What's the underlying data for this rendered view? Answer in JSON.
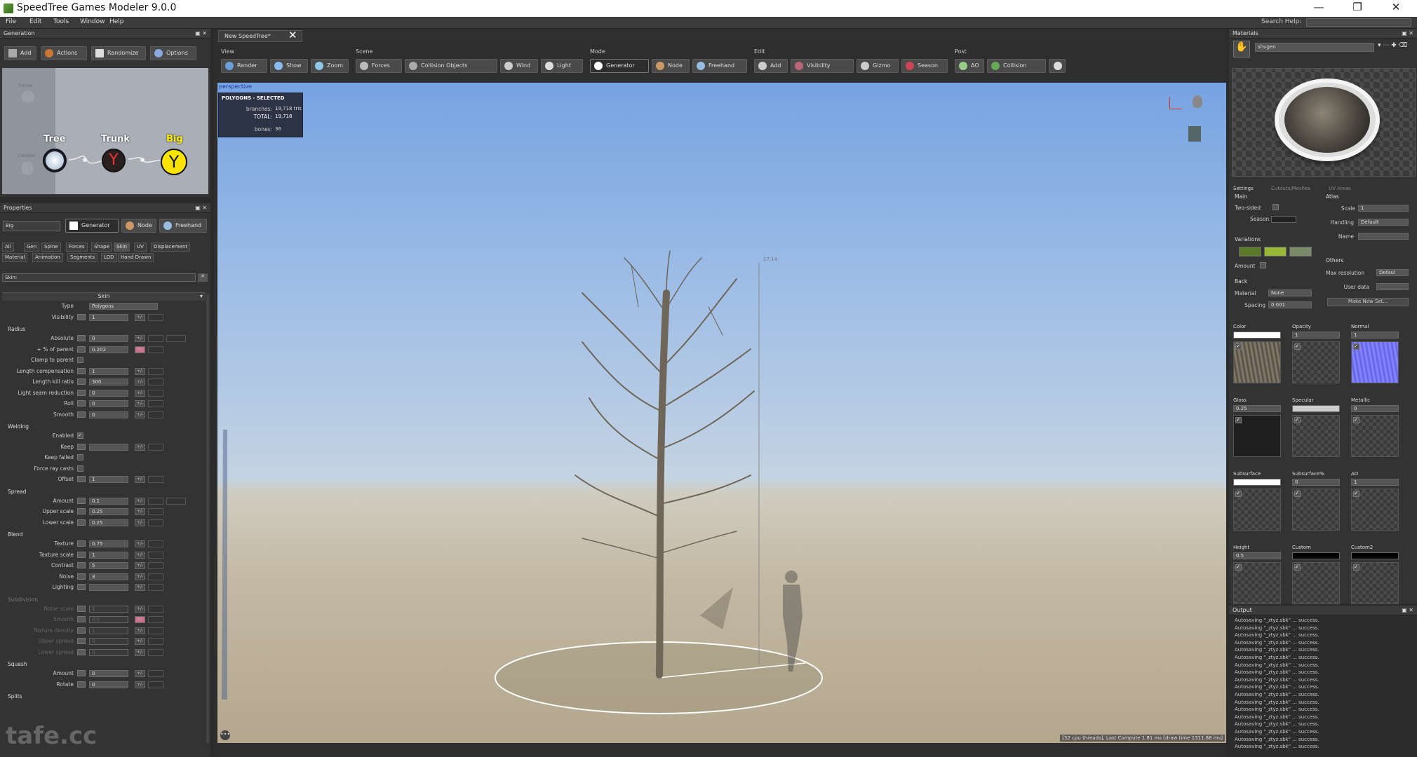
{
  "app": {
    "title": "SpeedTree Games Modeler 9.0.0"
  },
  "menu": [
    "File",
    "Edit",
    "Tools",
    "Window",
    "Help"
  ],
  "search_help_label": "Search Help:",
  "generation": {
    "title": "Generation",
    "buttons": [
      "Add",
      "Actions",
      "Randomize",
      "Options"
    ],
    "nodes": [
      {
        "label": "Tree",
        "color": "#e8f0ff"
      },
      {
        "label": "Trunk",
        "color": "#ffffff"
      },
      {
        "label": "Big",
        "color": "#ffee00"
      }
    ],
    "ghost": [
      "Forces",
      "Collision"
    ]
  },
  "document_tab": "New SpeedTree*",
  "toolbar": {
    "groups": [
      {
        "label": "View",
        "items": [
          {
            "t": "Render",
            "c": "#6a9fd8"
          },
          {
            "t": "Show",
            "c": "#88bbee"
          },
          {
            "t": "Zoom",
            "c": "#8fc8e8"
          }
        ]
      },
      {
        "label": "Scene",
        "items": [
          {
            "t": "Forces",
            "c": "#bbbbbb"
          },
          {
            "t": "Collision Objects",
            "c": "#aaaaaa"
          },
          {
            "t": "Wind",
            "c": "#cccccc"
          },
          {
            "t": "Light",
            "c": "#dddddd"
          }
        ]
      },
      {
        "label": "Mode",
        "items": [
          {
            "t": "Generator",
            "c": "#ffffff",
            "on": true
          },
          {
            "t": "Node",
            "c": "#cc9966"
          },
          {
            "t": "Freehand",
            "c": "#99bbdd"
          }
        ]
      },
      {
        "label": "Edit",
        "items": [
          {
            "t": "Add",
            "c": "#cccccc"
          },
          {
            "t": "Visibility",
            "c": "#bb6677"
          },
          {
            "t": "Gizmo",
            "c": "#cccccc"
          },
          {
            "t": "Season",
            "c": "#cc4455"
          }
        ]
      },
      {
        "label": "Post",
        "items": [
          {
            "t": "AO",
            "c": "#99cc88"
          },
          {
            "t": "Collision",
            "c": "#66aa55"
          },
          {
            "t": "",
            "c": "#dddddd"
          }
        ]
      }
    ]
  },
  "viewport": {
    "label": "perspective",
    "info_title": "POLYGONS - SELECTED",
    "branches_label": "branches:",
    "branches_value": "19,718 tris",
    "total_label": "TOTAL:",
    "total_value": "19,718",
    "bones_label": "bones:",
    "bones_value": "36",
    "height_marker": "27.14",
    "status": "[32 cpu threads], Last Compute 1.81 ms [draw time 1311.86 ms]"
  },
  "properties": {
    "title": "Properties",
    "name_value": "Big",
    "mode_buttons": [
      "Generator",
      "Node",
      "Freehand"
    ],
    "tabs_row1": [
      "All",
      "Gen",
      "Spine",
      "Forces",
      "Shape",
      "Skin",
      "UV",
      "Displacement"
    ],
    "tabs_row2": [
      "Material",
      "Animation",
      "Segments",
      "LOD",
      "Hand Drawn"
    ],
    "filter": "Skin:",
    "section": "Skin",
    "rows": [
      {
        "k": "label",
        "t": "Type",
        "v": "Polygons",
        "dd": true
      },
      {
        "k": "label",
        "t": "Visibility",
        "v": "1"
      },
      {
        "k": "sec",
        "t": "Radius"
      },
      {
        "k": "label",
        "t": "Absolute",
        "v": "0",
        "curve": true
      },
      {
        "k": "label",
        "t": "+ % of parent",
        "v": "0.202",
        "pink": true
      },
      {
        "k": "check",
        "t": "Clamp to parent"
      },
      {
        "k": "label",
        "t": "Length compensation",
        "v": "1"
      },
      {
        "k": "label",
        "t": "Length kill ratio",
        "v": "300"
      },
      {
        "k": "label",
        "t": "Light seam reduction",
        "v": "0"
      },
      {
        "k": "label",
        "t": "Roll",
        "v": "0"
      },
      {
        "k": "label",
        "t": "Smooth",
        "v": "0"
      },
      {
        "k": "sec",
        "t": "Welding"
      },
      {
        "k": "check",
        "t": "Enabled",
        "on": true
      },
      {
        "k": "label",
        "t": "Keep",
        "v": ""
      },
      {
        "k": "check",
        "t": "Keep failed"
      },
      {
        "k": "check",
        "t": "Force ray casts"
      },
      {
        "k": "label",
        "t": "Offset",
        "v": "1"
      },
      {
        "k": "sec",
        "t": "Spread"
      },
      {
        "k": "label",
        "t": "Amount",
        "v": "0.1",
        "curve": true
      },
      {
        "k": "label",
        "t": "Upper scale",
        "v": "0.25"
      },
      {
        "k": "label",
        "t": "Lower scale",
        "v": "0.25"
      },
      {
        "k": "sec",
        "t": "Blend"
      },
      {
        "k": "label",
        "t": "Texture",
        "v": "0.75"
      },
      {
        "k": "label",
        "t": "Texture scale",
        "v": "1"
      },
      {
        "k": "label",
        "t": "Contrast",
        "v": "5"
      },
      {
        "k": "label",
        "t": "Noise",
        "v": "3"
      },
      {
        "k": "label",
        "t": "Lighting",
        "v": ""
      },
      {
        "k": "sec",
        "t": "Subdivision",
        "dim": true
      },
      {
        "k": "label",
        "t": "Noise scale",
        "v": "1",
        "dim": true
      },
      {
        "k": "label",
        "t": "Smooth",
        "v": "0.5",
        "dim": true,
        "pink": true
      },
      {
        "k": "label",
        "t": "Texture density",
        "v": "1",
        "dim": true
      },
      {
        "k": "label",
        "t": "Upper spread",
        "v": "0",
        "dim": true
      },
      {
        "k": "label",
        "t": "Lower spread",
        "v": "0",
        "dim": true
      },
      {
        "k": "sec",
        "t": "Squash"
      },
      {
        "k": "label",
        "t": "Amount",
        "v": "0"
      },
      {
        "k": "label",
        "t": "Rotate",
        "v": "0"
      },
      {
        "k": "sec",
        "t": "Splits"
      }
    ]
  },
  "materials": {
    "title": "Materials",
    "name_value": "shugen",
    "tabs": [
      "Settings",
      "Cutouts/Meshes",
      "UV Areas"
    ],
    "main": {
      "label": "Main",
      "two_sided": "Two-sided",
      "season": "Season"
    },
    "atlas": {
      "label": "Atlas",
      "scale_label": "Scale",
      "scale_value": "1",
      "handling_label": "Handling",
      "handling_value": "Default",
      "name_label": "Name"
    },
    "variations": {
      "label": "Variations",
      "amount": "Amount",
      "swatches": [
        "#5a7a2a",
        "#9ab838",
        "#7a8a6a"
      ]
    },
    "others": {
      "label": "Others",
      "maxres_label": "Max resolution",
      "maxres_value": "Defaul",
      "userdata_label": "User data",
      "make_set": "Make New Set..."
    },
    "back": {
      "label": "Back",
      "material_label": "Material",
      "material_value": "None",
      "spacing_label": "Spacing",
      "spacing_value": "0.001"
    },
    "maps": [
      {
        "name": "Color",
        "val": "",
        "swatch": "#ffffff",
        "tex": "bark"
      },
      {
        "name": "Opacity",
        "val": "1",
        "tex": "empty"
      },
      {
        "name": "Normal",
        "val": "1",
        "tex": "normal"
      },
      {
        "name": "Gloss",
        "val": "0.25",
        "tex": "dark"
      },
      {
        "name": "Specular",
        "val": "",
        "swatch": "#cccccc",
        "tex": "empty"
      },
      {
        "name": "Metallic",
        "val": "0",
        "tex": "empty"
      },
      {
        "name": "Subsurface",
        "val": "",
        "swatch": "#ffffff",
        "tex": "empty"
      },
      {
        "name": "Subsurface%",
        "val": "0",
        "tex": "empty"
      },
      {
        "name": "AO",
        "val": "1",
        "tex": "empty"
      },
      {
        "name": "Height",
        "val": "0.5",
        "tex": "empty"
      },
      {
        "name": "Custom",
        "val": "",
        "swatch": "#000000",
        "tex": "empty"
      },
      {
        "name": "Custom2",
        "val": "",
        "swatch": "#000000",
        "tex": "empty"
      }
    ]
  },
  "output": {
    "title": "Output",
    "lines": [
      "Autosaving \"_ztyz.sbk\" ... success.",
      "Autosaving \"_ztyz.sbk\" ... success.",
      "Autosaving \"_ztyz.sbk\" ... success.",
      "Autosaving \"_ztyz.sbk\" ... success.",
      "Autosaving \"_ztyz.sbk\" ... success.",
      "Autosaving \"_ztyz.sbk\" ... success.",
      "Autosaving \"_ztyz.sbk\" ... success.",
      "Autosaving \"_ztyz.sbk\" ... success.",
      "Autosaving \"_ztyz.sbk\" ... success.",
      "Autosaving \"_ztyz.sbk\" ... success.",
      "Autosaving \"_ztyz.sbk\" ... success.",
      "Autosaving \"_ztyz.sbk\" ... success.",
      "Autosaving \"_ztyz.sbk\" ... success.",
      "Autosaving \"_ztyz.sbk\" ... success.",
      "Autosaving \"_ztyz.sbk\" ... success.",
      "Autosaving \"_ztyz.sbk\" ... success.",
      "Autosaving \"_ztyz.sbk\" ... success.",
      "Autosaving \"_ztyz.sbk\" ... success."
    ]
  },
  "watermark": "tafe.cc"
}
